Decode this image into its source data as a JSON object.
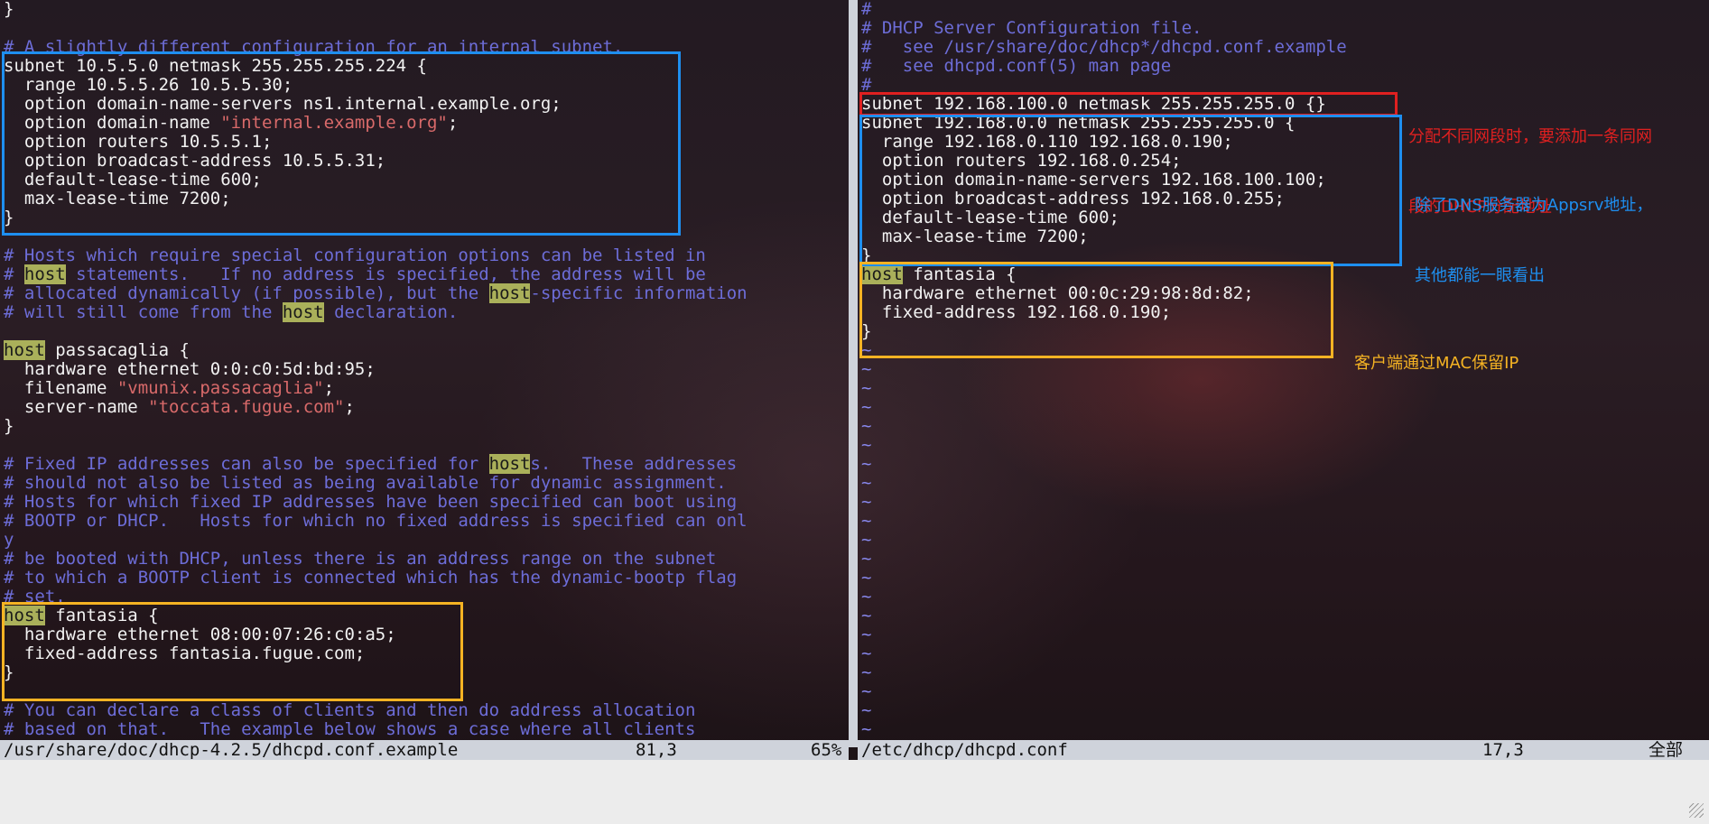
{
  "left_pane": {
    "lines": [
      [
        {
          "t": "}"
        }
      ],
      [
        {
          "t": ""
        }
      ],
      [
        {
          "t": "# A slightly different configuration for an internal subnet.",
          "c": "comment"
        }
      ],
      [
        {
          "t": "subnet 10.5.5.0 netmask 255.255.255.224 {"
        }
      ],
      [
        {
          "t": "  range 10.5.5.26 10.5.5.30;"
        }
      ],
      [
        {
          "t": "  option domain-name-servers ns1.internal.example.org;"
        }
      ],
      [
        {
          "t": "  option domain-name "
        },
        {
          "t": "\"internal.example.org\"",
          "c": "string"
        },
        {
          "t": ";"
        }
      ],
      [
        {
          "t": "  option routers 10.5.5.1;"
        }
      ],
      [
        {
          "t": "  option broadcast-address 10.5.5.31;"
        }
      ],
      [
        {
          "t": "  default-lease-time 600;"
        }
      ],
      [
        {
          "t": "  max-lease-time 7200;"
        }
      ],
      [
        {
          "t": "}"
        }
      ],
      [
        {
          "t": ""
        }
      ],
      [
        {
          "t": "# Hosts which require special configuration options can be listed in",
          "c": "comment"
        }
      ],
      [
        {
          "t": "# ",
          "c": "comment"
        },
        {
          "t": "host",
          "c": "hl"
        },
        {
          "t": " statements.   If no address is specified, the address will be",
          "c": "comment"
        }
      ],
      [
        {
          "t": "# allocated dynamically (if possible), but the ",
          "c": "comment"
        },
        {
          "t": "host",
          "c": "hl"
        },
        {
          "t": "-specific information",
          "c": "comment"
        }
      ],
      [
        {
          "t": "# will still come from the ",
          "c": "comment"
        },
        {
          "t": "host",
          "c": "hl"
        },
        {
          "t": " declaration.",
          "c": "comment"
        }
      ],
      [
        {
          "t": ""
        }
      ],
      [
        {
          "t": "host",
          "c": "hl"
        },
        {
          "t": " passacaglia {"
        }
      ],
      [
        {
          "t": "  hardware ethernet 0:0:c0:5d:bd:95;"
        }
      ],
      [
        {
          "t": "  filename "
        },
        {
          "t": "\"vmunix.passacaglia\"",
          "c": "string"
        },
        {
          "t": ";"
        }
      ],
      [
        {
          "t": "  server-name "
        },
        {
          "t": "\"toccata.fugue.com\"",
          "c": "string"
        },
        {
          "t": ";"
        }
      ],
      [
        {
          "t": "}"
        }
      ],
      [
        {
          "t": ""
        }
      ],
      [
        {
          "t": "# Fixed IP addresses can also be specified for ",
          "c": "comment"
        },
        {
          "t": "host",
          "c": "hl"
        },
        {
          "t": "s.   These addresses",
          "c": "comment"
        }
      ],
      [
        {
          "t": "# should not also be listed as being available for dynamic assignment.",
          "c": "comment"
        }
      ],
      [
        {
          "t": "# Hosts for which fixed IP addresses have been specified can boot using",
          "c": "comment"
        }
      ],
      [
        {
          "t": "# BOOTP or DHCP.   Hosts for which no fixed address is specified can onl",
          "c": "comment"
        }
      ],
      [
        {
          "t": "y",
          "c": "comment"
        }
      ],
      [
        {
          "t": "# be booted with DHCP, unless there is an address range on the subnet",
          "c": "comment"
        }
      ],
      [
        {
          "t": "# to which a BOOTP client is connected which has the dynamic-bootp flag",
          "c": "comment"
        }
      ],
      [
        {
          "t": "# set.",
          "c": "comment"
        }
      ],
      [
        {
          "t": "host",
          "c": "hl"
        },
        {
          "t": " fantasia {"
        }
      ],
      [
        {
          "t": "  hardware ethernet 08:00:07:26:c0:a5;"
        }
      ],
      [
        {
          "t": "  fixed-address fantasia.fugue.com;"
        }
      ],
      [
        {
          "t": "}"
        }
      ],
      [
        {
          "t": ""
        }
      ],
      [
        {
          "t": "# You can declare a class of clients and then do address allocation",
          "c": "comment"
        }
      ],
      [
        {
          "t": "# based on that.   The example below shows a case where all clients",
          "c": "comment"
        }
      ]
    ]
  },
  "right_pane": {
    "lines": [
      [
        {
          "t": "#",
          "c": "comment"
        }
      ],
      [
        {
          "t": "# DHCP Server Configuration file.",
          "c": "comment"
        }
      ],
      [
        {
          "t": "#   see /usr/share/doc/dhcp*/dhcpd.conf.example",
          "c": "comment"
        }
      ],
      [
        {
          "t": "#   see dhcpd.conf(5) man page",
          "c": "comment"
        }
      ],
      [
        {
          "t": "#",
          "c": "comment"
        }
      ],
      [
        {
          "t": "subnet 192.168.100.0 netmask 255.255.255.0 {}"
        }
      ],
      [
        {
          "t": "subnet 192.168.0.0 netmask 255.255.255.0 {"
        }
      ],
      [
        {
          "t": "  range 192.168.0.110 192.168.0.190;"
        }
      ],
      [
        {
          "t": "  option routers 192.168.0.254;"
        }
      ],
      [
        {
          "t": "  option domain-name-servers 192.168.100.100;"
        }
      ],
      [
        {
          "t": "  option broadcast-address 192.168.0.255;"
        }
      ],
      [
        {
          "t": "  default-lease-time 600;"
        }
      ],
      [
        {
          "t": "  max-lease-time 7200;"
        }
      ],
      [
        {
          "t": "}"
        }
      ],
      [
        {
          "t": "host",
          "c": "hl"
        },
        {
          "t": " fantasia {"
        }
      ],
      [
        {
          "t": "  hardware ethernet 00:0c:29:98:8d:82;"
        }
      ],
      [
        {
          "t": "  fixed-address 192.168.0.190;"
        }
      ],
      [
        {
          "t": "}"
        }
      ],
      [
        {
          "t": "~",
          "c": "tilde"
        }
      ],
      [
        {
          "t": "~",
          "c": "tilde"
        }
      ],
      [
        {
          "t": "~",
          "c": "tilde"
        }
      ],
      [
        {
          "t": "~",
          "c": "tilde"
        }
      ],
      [
        {
          "t": "~",
          "c": "tilde"
        }
      ],
      [
        {
          "t": "~",
          "c": "tilde"
        }
      ],
      [
        {
          "t": "~",
          "c": "tilde"
        }
      ],
      [
        {
          "t": "~",
          "c": "tilde"
        }
      ],
      [
        {
          "t": "~",
          "c": "tilde"
        }
      ],
      [
        {
          "t": "~",
          "c": "tilde"
        }
      ],
      [
        {
          "t": "~",
          "c": "tilde"
        }
      ],
      [
        {
          "t": "~",
          "c": "tilde"
        }
      ],
      [
        {
          "t": "~",
          "c": "tilde"
        }
      ],
      [
        {
          "t": "~",
          "c": "tilde"
        }
      ],
      [
        {
          "t": "~",
          "c": "tilde"
        }
      ],
      [
        {
          "t": "~",
          "c": "tilde"
        }
      ],
      [
        {
          "t": "~",
          "c": "tilde"
        }
      ],
      [
        {
          "t": "~",
          "c": "tilde"
        }
      ],
      [
        {
          "t": "~",
          "c": "tilde"
        }
      ],
      [
        {
          "t": "~",
          "c": "tilde"
        }
      ],
      [
        {
          "t": "~",
          "c": "tilde"
        }
      ]
    ]
  },
  "status": {
    "left_file": "/usr/share/doc/dhcp-4.2.5/dhcpd.conf.example",
    "left_position": "81,3",
    "left_percent": "65%",
    "right_file": "/etc/dhcp/dhcpd.conf",
    "right_position": "17,3",
    "right_percent": "全部"
  },
  "annotations": {
    "red_note_line1": "分配不同网段时，要添加一条同网",
    "red_note_line2": "段的DHCP分配地址",
    "blue_note_line1": "除了DNS服务器为Appsrv地址，",
    "blue_note_line2": "其他都能一眼看出",
    "orange_note": "客户端通过MAC保留IP"
  },
  "colors": {
    "annotation_red": "#e02020",
    "annotation_blue": "#1e8ff0",
    "annotation_orange": "#f5b323"
  }
}
